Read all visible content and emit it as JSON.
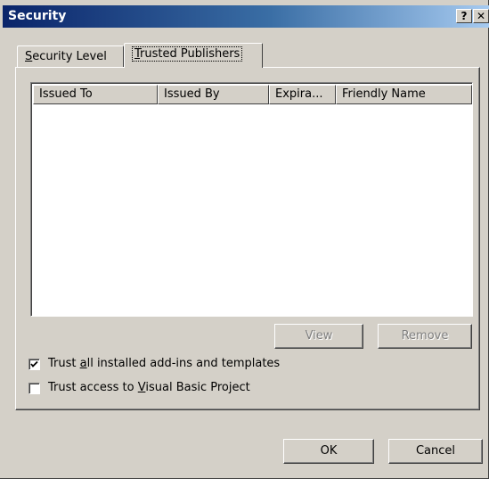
{
  "window": {
    "title": "Security",
    "help_glyph": "?",
    "close_glyph": "✕"
  },
  "tabs": [
    {
      "pre": "",
      "mnemonic": "S",
      "post": "ecurity Level",
      "active": false
    },
    {
      "pre": "",
      "mnemonic": "T",
      "post": "rusted Publishers",
      "active": true
    }
  ],
  "list": {
    "columns": [
      "Issued To",
      "Issued By",
      "Expira...",
      "Friendly Name"
    ],
    "rows": []
  },
  "buttons": {
    "view": "View",
    "remove": "Remove",
    "ok": "OK",
    "cancel": "Cancel"
  },
  "options": {
    "trust_addins": {
      "pre": "Trust ",
      "mnemonic": "a",
      "post": "ll installed add-ins and templates",
      "checked": true
    },
    "trust_vba": {
      "pre": "Trust access to ",
      "mnemonic": "V",
      "post": "isual Basic Project",
      "checked": false
    }
  }
}
